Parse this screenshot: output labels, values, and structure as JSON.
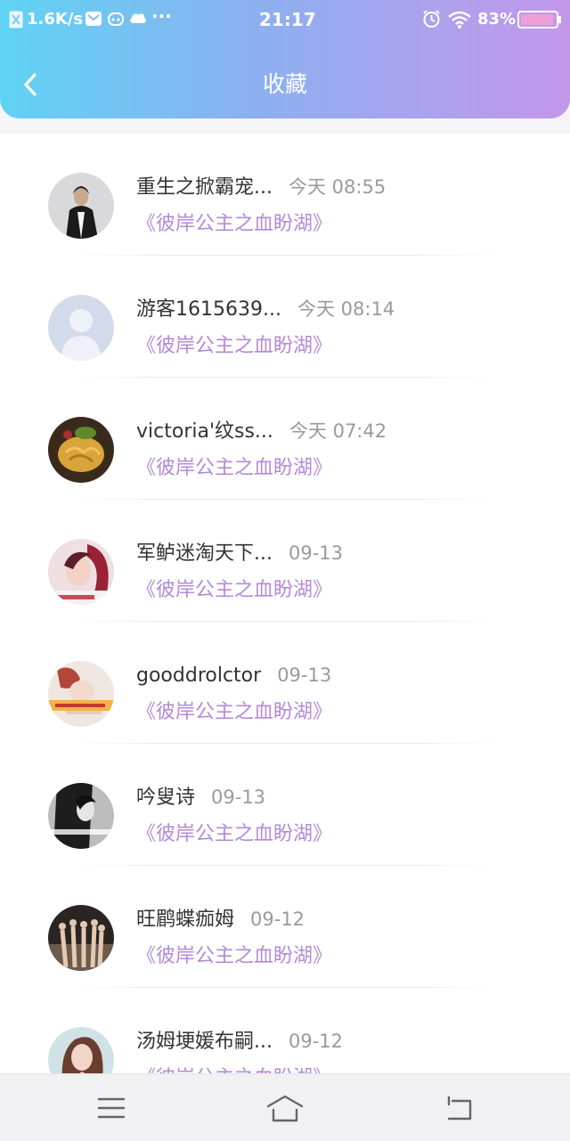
{
  "status_bar": {
    "network_speed": "1.6K/s",
    "time": "21:17",
    "battery": "83%",
    "icons": [
      "sim-icon",
      "mail-icon",
      "cat-icon",
      "cloud-icon",
      "more-dots-icon",
      "alarm-icon",
      "wifi-icon",
      "battery-icon"
    ]
  },
  "header": {
    "title": "收藏",
    "back_icon": "chevron-left-icon"
  },
  "colors": {
    "header_gradient": [
      "#5fd3f3",
      "#8cb0ef",
      "#c497eb"
    ],
    "book_title": "#b48ad8",
    "name_text": "#333333",
    "time_text": "#9a9a9a"
  },
  "favorites": [
    {
      "name": "重生之掀霸宠...",
      "time": "今天 08:55",
      "book": "《彼岸公主之血盼湖》"
    },
    {
      "name": "游客1615639...",
      "time": "今天 08:14",
      "book": "《彼岸公主之血盼湖》"
    },
    {
      "name": "victoria'纹ss...",
      "time": "今天 07:42",
      "book": "《彼岸公主之血盼湖》"
    },
    {
      "name": "军鲈迷淘天下...",
      "time": "09-13",
      "book": "《彼岸公主之血盼湖》"
    },
    {
      "name": "gooddrolctor",
      "time": "09-13",
      "book": "《彼岸公主之血盼湖》"
    },
    {
      "name": "吟叟诗",
      "time": "09-13",
      "book": "《彼岸公主之血盼湖》"
    },
    {
      "name": "旺鹛蝶痂姆",
      "time": "09-12",
      "book": "《彼岸公主之血盼湖》"
    },
    {
      "name": "汤姆埂媛布嗣...",
      "time": "09-12",
      "book": "《彼岸公主之血盼湖》"
    }
  ],
  "nav_bar": {
    "icons": [
      "menu-icon",
      "home-icon",
      "back-icon"
    ]
  }
}
